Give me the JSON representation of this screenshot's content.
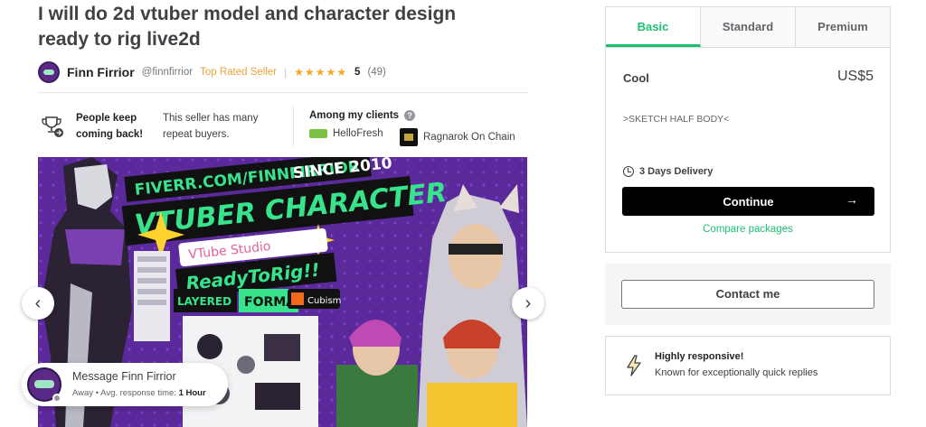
{
  "gig": {
    "title": "I will do 2d vtuber model and character design ready to rig live2d"
  },
  "seller": {
    "name": "Finn Firrior",
    "handle": "@finnfirrior",
    "badge": "Top Rated Seller",
    "separator": "|",
    "stars": "★★★★★",
    "rating": "5",
    "reviews": "(49)"
  },
  "highlights": {
    "bold": "People keep coming back!",
    "text": "This seller has many repeat buyers.",
    "icon": "trophy-icon"
  },
  "clients": {
    "title": "Among my clients",
    "help": "?",
    "items": [
      {
        "name": "HelloFresh",
        "logo": "hellofresh-logo"
      },
      {
        "name": "Ragnarok On Chain",
        "logo": "ragnarok-logo"
      }
    ]
  },
  "gallery": {
    "texts": {
      "line1": "FIVERR.COM/FINNFIRRIOR",
      "line2": "SINCE 2010",
      "line3": "VTUBER CHARACTER",
      "line4": "VTube Studio",
      "line5": "ReadyToRig!!",
      "line6": "LAYERED",
      "line7": "FORMAT!!",
      "line8": "Cubism"
    },
    "prev": "‹",
    "next": "›"
  },
  "message": {
    "title": "Message Finn Firrior",
    "status": "Away",
    "dot": "•",
    "response_label": "Avg. response time:",
    "response_value": "1 Hour"
  },
  "packages": {
    "tabs": [
      "Basic",
      "Standard",
      "Premium"
    ],
    "active_tab": "Basic",
    "name": "Cool",
    "price": "US$5",
    "description": ">SKETCH HALF BODY<",
    "delivery": "3 Days Delivery",
    "continue": "Continue",
    "arrow": "→",
    "compare": "Compare packages"
  },
  "contact": {
    "label": "Contact me"
  },
  "responsive": {
    "title": "Highly responsive!",
    "text": "Known for exceptionally quick replies"
  },
  "colors": {
    "accent": "#1dbf73",
    "primary_button": "#000000",
    "top_rated": "#e8a33b",
    "star": "#f5a623",
    "gallery_bg": "#5a2a9a"
  }
}
